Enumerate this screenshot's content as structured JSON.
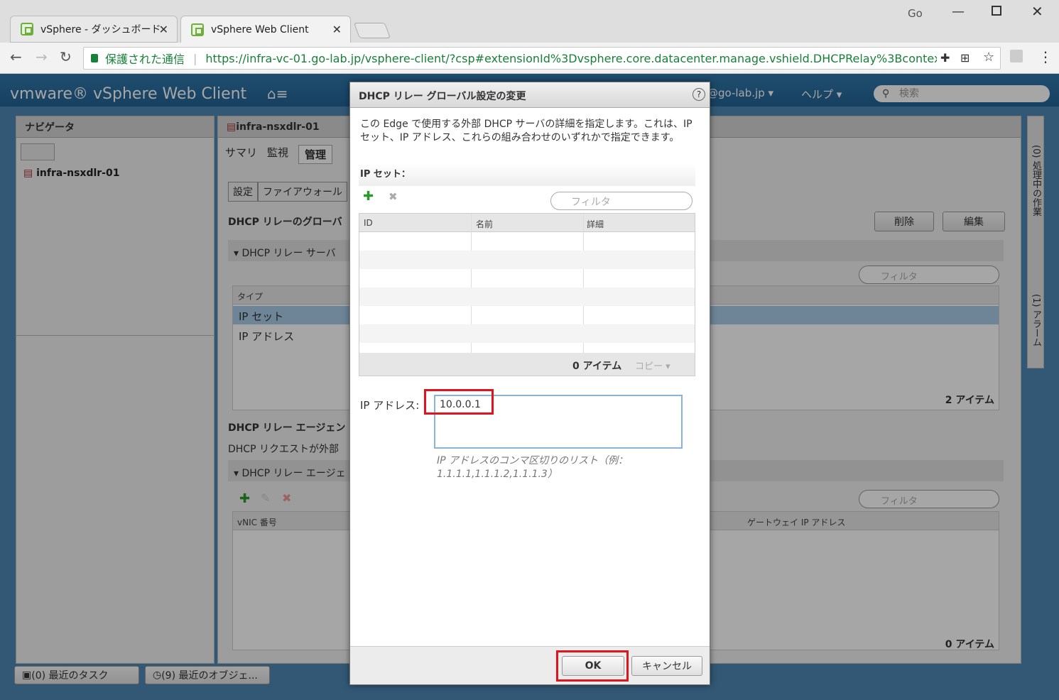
{
  "browser": {
    "tabs": [
      {
        "label": "vSphere - ダッシュボード"
      },
      {
        "label": "vSphere Web Client"
      }
    ],
    "profile": "Go",
    "secure_label": "保護された通信",
    "url": "https://infra-vc-01.go-lab.jp/vsphere-client/?csp#extensionId%3Dvsphere.core.datacenter.manage.vshield.DHCPRelay%3Bcontext%..."
  },
  "vmware": {
    "brand": "vmware® vSphere Web Client",
    "user": "@go-lab.jp ▾",
    "help": "ヘルプ ▾",
    "search_placeholder": "検索"
  },
  "navigator": {
    "title": "ナビゲータ",
    "item": "infra-nsxdlr-01"
  },
  "object": {
    "title": "infra-nsxdlr-01",
    "tabs": [
      "サマリ",
      "監視",
      "管理"
    ],
    "subtabs": [
      "設定",
      "ファイアウォール"
    ],
    "relay_global_title": "DHCP リレーのグローバ",
    "relay_servers": "DHCP リレー サーバ",
    "col_type": "タイプ",
    "types": [
      "IP セット",
      "IP アドレス"
    ],
    "filter": "フィルタ",
    "count": "2 アイテム",
    "delete": "削除",
    "edit": "編集",
    "agents_title": "DHCP リレー エージェン",
    "agents_desc": "DHCP リクエストが外部",
    "agents_sub": "DHCP リレー エージェ",
    "col_vnic": "vNIC 番号",
    "col_gw": "ゲートウェイ IP アドレス",
    "agents_count": "0 アイテム"
  },
  "right_panel": {
    "tasks": "(0) 処理中の作業",
    "alarms": "(1) アラーム"
  },
  "bottom": {
    "recent_tasks": "(0) 最近のタスク",
    "recent_objects": "(9) 最近のオブジェ..."
  },
  "dialog": {
    "title": "DHCP リレー グローバル設定の変更",
    "description": "この Edge で使用する外部 DHCP サーバの詳細を指定します。これは、IP セット、IP アドレス、これらの組み合わせのいずれかで指定できます。",
    "ipset_label": "IP セット：",
    "filter": "フィルタ",
    "columns": [
      "ID",
      "名前",
      "詳細"
    ],
    "count": "0 アイテム",
    "copy": "コピー ▾",
    "ip_label": "IP アドレス:",
    "ip_value": "10.0.0.1",
    "hint": "IP アドレスのコンマ区切りのリスト（例：1.1.1.1,1.1.1.2,1.1.1.3）",
    "ok": "OK",
    "cancel": "キャンセル"
  },
  "colors": {
    "accent": "#2c6fa2",
    "highlight": "#e0141e",
    "selection": "#a8cce8"
  }
}
